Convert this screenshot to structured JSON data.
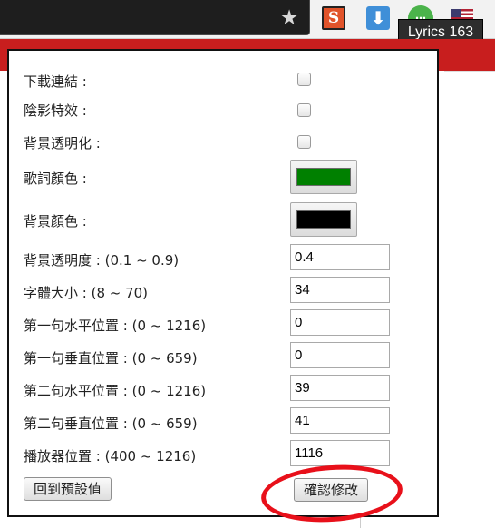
{
  "browser": {
    "tooltip": "Lyrics 163",
    "extensions": [
      "bookmark-star-icon",
      "s-extension-icon",
      "download-icon",
      "green-extension-icon",
      "us-flag-icon"
    ]
  },
  "settings": {
    "download_link": {
      "label": "下載連結 :",
      "checked": false
    },
    "shadow_effect": {
      "label": "陰影特效 :",
      "checked": false
    },
    "bg_transparent": {
      "label": "背景透明化 :",
      "checked": false
    },
    "lyric_color": {
      "label": "歌詞顏色 :",
      "color": "#008000"
    },
    "bg_color": {
      "label": "背景顏色 :",
      "color": "#000000"
    },
    "bg_opacity": {
      "label": "背景透明度 : (0.1 ~ 0.9)",
      "value": "0.4"
    },
    "font_size": {
      "label": "字體大小 : (8 ~ 70)",
      "value": "34"
    },
    "line1_x": {
      "label": "第一句水平位置 : (0 ~ 1216)",
      "value": "0"
    },
    "line1_y": {
      "label": "第一句垂直位置 : (0 ~ 659)",
      "value": "0"
    },
    "line2_x": {
      "label": "第二句水平位置 : (0 ~ 1216)",
      "value": "39"
    },
    "line2_y": {
      "label": "第二句垂直位置 : (0 ~ 659)",
      "value": "41"
    },
    "player_pos": {
      "label": "播放器位置 : (400 ~ 1216)",
      "value": "1116"
    }
  },
  "buttons": {
    "reset": "回到預設值",
    "confirm": "確認修改"
  },
  "colors": {
    "annotation_circle": "#e8101a",
    "page_bar": "#c81e1e"
  }
}
